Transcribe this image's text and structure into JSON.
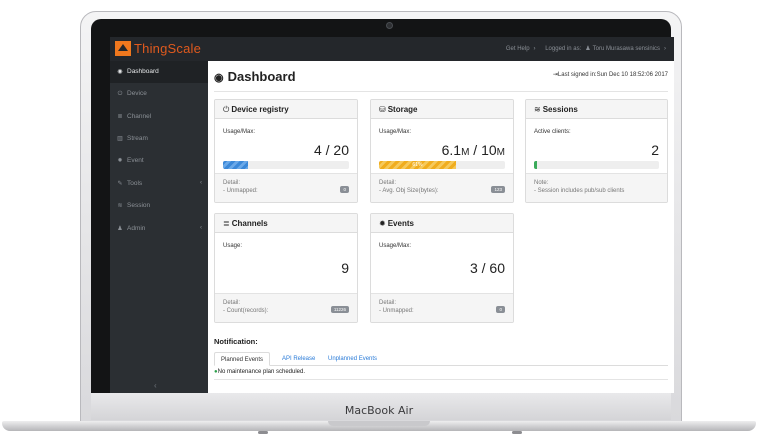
{
  "device": {
    "brand_label": "MacBook Air"
  },
  "colors": {
    "accent": "#f0781e",
    "sidebar": "#2b2f33",
    "topbar": "#24272b",
    "progress_blue": "#3b88d8",
    "progress_yellow": "#f0ad1e",
    "progress_green": "#3aaa5a"
  },
  "topbar": {
    "logo_text": "ThingScale",
    "help_label": "Get Help",
    "help_chevron": "›",
    "logged_in_label": "Logged in as:",
    "user_icon": "user-icon",
    "user_name": "Toru Murasawa sensinics",
    "user_chevron": "›"
  },
  "sidebar": {
    "items": [
      {
        "label": "Dashboard",
        "icon": "dashboard-icon",
        "glyph": "◉",
        "active": true
      },
      {
        "label": "Device",
        "icon": "power-icon",
        "glyph": "⏻"
      },
      {
        "label": "Channel",
        "icon": "database-icon",
        "glyph": "≣"
      },
      {
        "label": "Stream",
        "icon": "chart-icon",
        "glyph": "▥"
      },
      {
        "label": "Event",
        "icon": "gear-icon",
        "glyph": "✹"
      },
      {
        "label": "Tools",
        "icon": "wrench-icon",
        "glyph": "✎",
        "chevron": "‹"
      },
      {
        "label": "Session",
        "icon": "rss-icon",
        "glyph": "≋"
      },
      {
        "label": "Admin",
        "icon": "user-icon",
        "glyph": "♟",
        "chevron": "‹"
      }
    ],
    "collapse_glyph": "‹"
  },
  "page": {
    "title": "Dashboard",
    "title_glyph": "◉",
    "last_signed": "Last signed in:Sun Dec 10 18:52:06 2017",
    "last_signed_glyph": "⇥"
  },
  "panels": {
    "device_registry": {
      "title": "Device registry",
      "glyph": "⏻",
      "label": "Usage/Max:",
      "value": "4 / 20",
      "progress": 0.2,
      "detail_label": "Detail:",
      "detail_text": "- Unmapped:",
      "badge": "0"
    },
    "storage": {
      "title": "Storage",
      "glyph": "⛁",
      "label": "Usage/Max:",
      "value_num": "6.1",
      "value_unit1": "M",
      "value_sep": " / 10",
      "value_unit2": "M",
      "progress": 0.61,
      "progress_text": "61%",
      "detail_label": "Detail:",
      "detail_text": "- Avg. Obj Size(bytes):",
      "badge": "123"
    },
    "sessions": {
      "title": "Sessions",
      "glyph": "≋",
      "label": "Active clients:",
      "value": "2",
      "progress": 0.02,
      "note_label": "Note:",
      "note_text": "- Session includes pub/sub clients"
    },
    "channels": {
      "title": "Channels",
      "glyph": "≣",
      "label": "Usage:",
      "value": "9",
      "detail_label": "Detail:",
      "detail_text": "- Count(records):",
      "badge": "11226"
    },
    "events": {
      "title": "Events",
      "glyph": "✹",
      "label": "Usage/Max:",
      "value": "3 / 60",
      "detail_label": "Detail:",
      "detail_text": "- Unmapped:",
      "badge": "0"
    }
  },
  "notification": {
    "title": "Notification:",
    "tabs": [
      {
        "label": "Planned Events",
        "active": true
      },
      {
        "label": "API Release"
      },
      {
        "label": "Unplanned Events"
      }
    ],
    "message": "No maintenance plan scheduled.",
    "message_glyph": "●"
  }
}
